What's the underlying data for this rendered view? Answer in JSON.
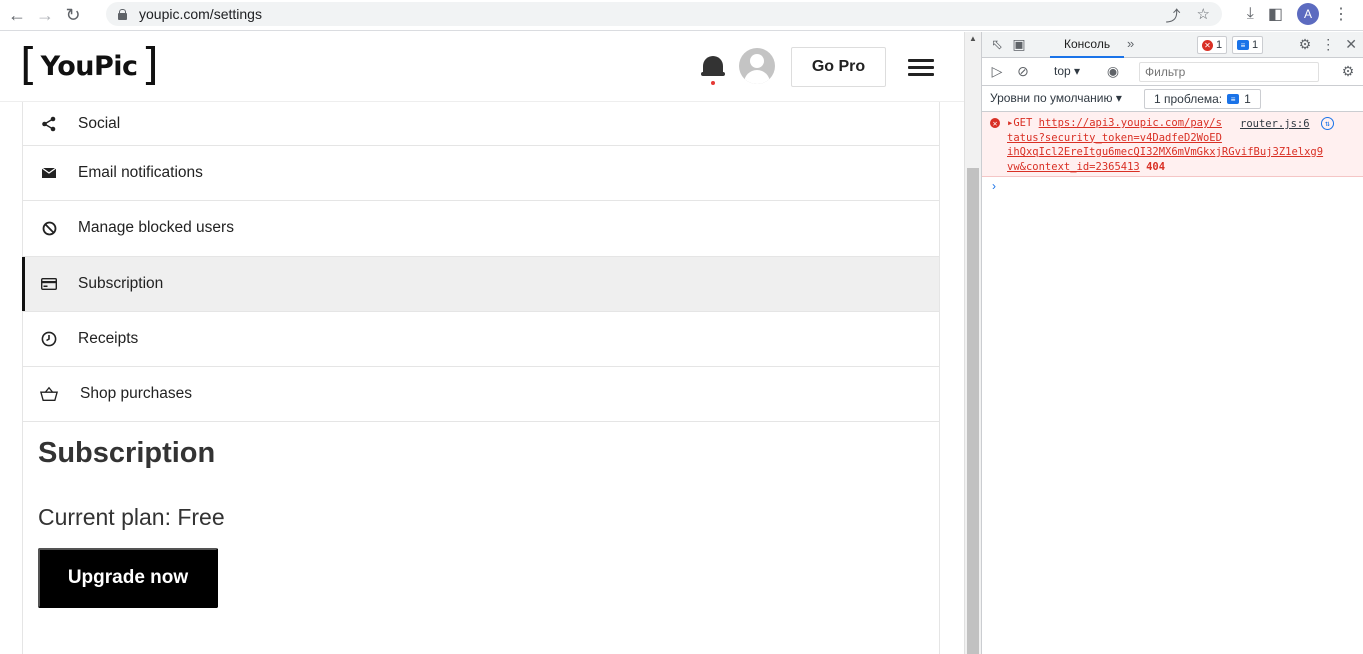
{
  "browser": {
    "url": "youpic.com/settings",
    "profile_initial": "A"
  },
  "site": {
    "logo": {
      "left": "[",
      "text": "YouPic",
      "right": "]"
    },
    "go_pro_label": "Go Pro",
    "settings_menu": [
      {
        "label": "Social",
        "icon": "share-icon"
      },
      {
        "label": "Email notifications",
        "icon": "mail-icon"
      },
      {
        "label": "Manage blocked users",
        "icon": "block-icon"
      },
      {
        "label": "Subscription",
        "icon": "card-icon",
        "active": true
      },
      {
        "label": "Receipts",
        "icon": "clock-icon"
      },
      {
        "label": "Shop purchases",
        "icon": "basket-icon"
      }
    ],
    "section_title": "Subscription",
    "current_plan": "Current plan: Free",
    "upgrade_label": "Upgrade now"
  },
  "devtools": {
    "tab_console": "Консоль",
    "error_count": "1",
    "info_count": "1",
    "context": "top",
    "filter_placeholder": "Фильтр",
    "levels_label": "Уровни по умолчанию",
    "issues_label": "1 проблема:",
    "issues_count": "1",
    "error": {
      "method": "GET",
      "url_line1": "https://api3.youpic.com/pay/s",
      "url_line2": "tatus?security_token=v4DadfeD2WoED",
      "url_line3": "ihQxqIcl2EreItgu6mecQI32MX6mVmGkxjRGvifBuj3Z1elxg9",
      "url_line4": "vw&context_id=2365413",
      "status": "404",
      "source": "router.js:6"
    },
    "colors": {
      "error": "#d93025",
      "accent": "#1a73e8"
    }
  }
}
